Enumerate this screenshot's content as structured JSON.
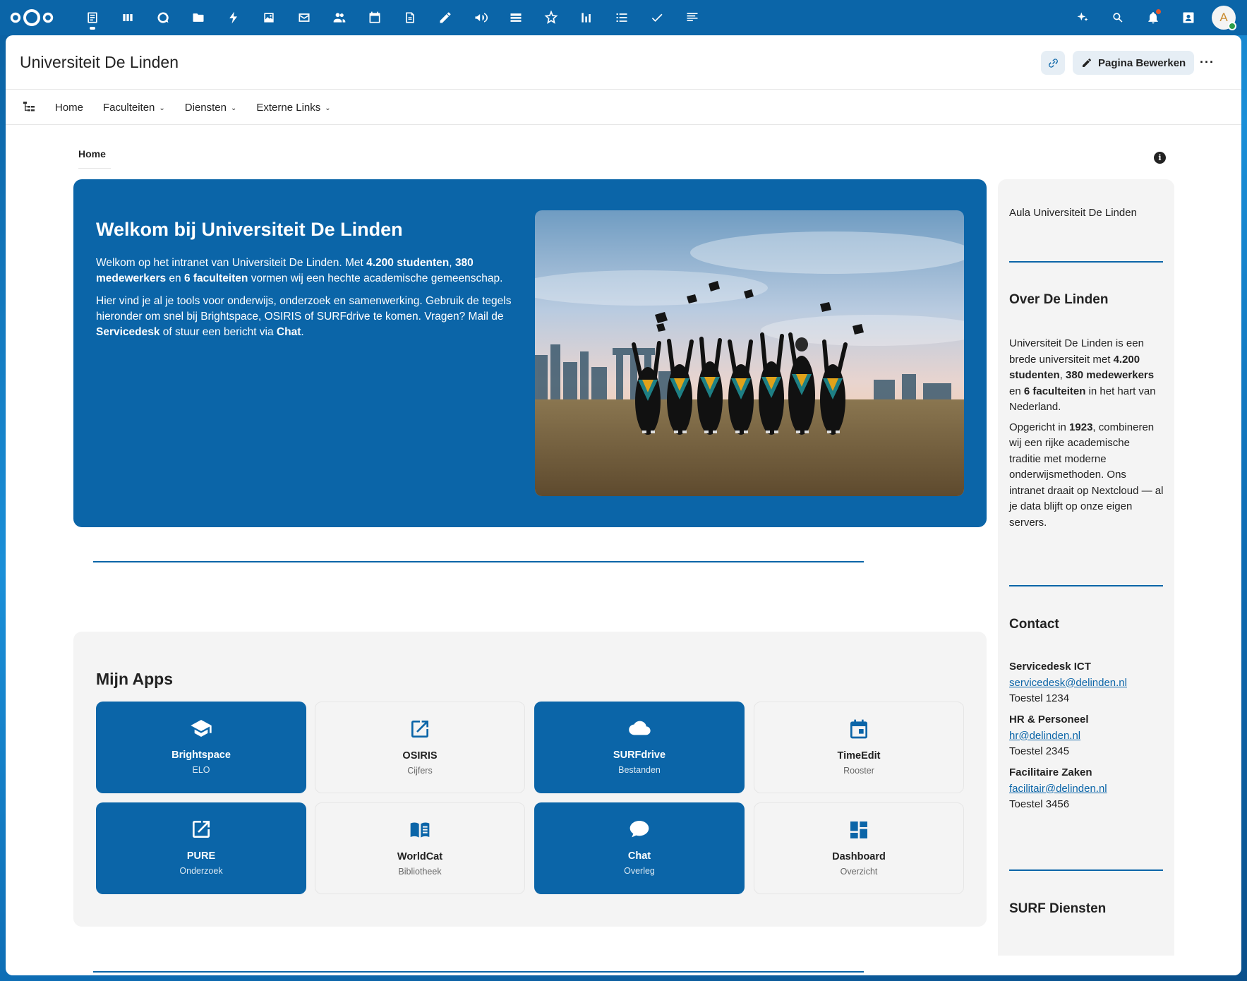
{
  "header": {
    "page_title": "Universiteit De Linden",
    "edit_label": "Pagina Bewerken",
    "more_label": "···"
  },
  "topbar": {
    "apps": [
      "home-app",
      "activity-app",
      "deck-app",
      "talk-app",
      "files-app",
      "flow-app",
      "photos-app",
      "mail-app",
      "contacts-app",
      "calendar-app",
      "notes-app",
      "whiteboard-app",
      "announcements-app",
      "tables-app",
      "collectives-app",
      "analytics-app",
      "tasks-app",
      "done-app",
      "forms-app"
    ],
    "avatar_letter": "A"
  },
  "nav": {
    "items": [
      {
        "label": "Home",
        "dropdown": false
      },
      {
        "label": "Faculteiten",
        "dropdown": true
      },
      {
        "label": "Diensten",
        "dropdown": true
      },
      {
        "label": "Externe Links",
        "dropdown": true
      }
    ]
  },
  "breadcrumb": "Home",
  "hero": {
    "title": "Welkom bij Universiteit De Linden",
    "p1_a": "Welkom op het intranet van Universiteit De Linden. Met ",
    "p1_b": "4.200 studenten",
    "p1_c": ", ",
    "p1_d": "380 medewerkers",
    "p1_e": " en ",
    "p1_f": "6 faculteiten",
    "p1_g": " vormen wij een hechte academische gemeenschap.",
    "p2_a": "Hier vind je al je tools voor onderwijs, onderzoek en samenwerking. Gebruik de tegels hieronder om snel bij Brightspace, OSIRIS of SURFdrive te komen. Vragen? Mail de ",
    "p2_b": "Servicedesk",
    "p2_c": " of stuur een bericht via ",
    "p2_d": "Chat",
    "p2_e": "."
  },
  "apps": {
    "title": "Mijn Apps",
    "tiles": [
      {
        "name": "Brightspace",
        "sub": "ELO",
        "style": "blue",
        "icon": "graduation-cap-icon"
      },
      {
        "name": "OSIRIS",
        "sub": "Cijfers",
        "style": "white",
        "icon": "external-link-icon"
      },
      {
        "name": "SURFdrive",
        "sub": "Bestanden",
        "style": "blue",
        "icon": "cloud-icon"
      },
      {
        "name": "TimeEdit",
        "sub": "Rooster",
        "style": "white",
        "icon": "calendar-icon"
      },
      {
        "name": "PURE",
        "sub": "Onderzoek",
        "style": "blue",
        "icon": "external-link-icon"
      },
      {
        "name": "WorldCat",
        "sub": "Bibliotheek",
        "style": "white",
        "icon": "book-icon"
      },
      {
        "name": "Chat",
        "sub": "Overleg",
        "style": "blue",
        "icon": "chat-bubble-icon"
      },
      {
        "name": "Dashboard",
        "sub": "Overzicht",
        "style": "white",
        "icon": "dashboard-icon"
      }
    ]
  },
  "sidebar": {
    "caption": "Aula Universiteit De Linden",
    "about_title": "Over De Linden",
    "about_p1_a": "Universiteit De Linden is een brede universiteit met ",
    "about_p1_b": "4.200 studenten",
    "about_p1_c": ", ",
    "about_p1_d": "380 medewerkers",
    "about_p1_e": " en ",
    "about_p1_f": "6 faculteiten",
    "about_p1_g": " in het hart van Nederland.",
    "about_p2_a": "Opgericht in ",
    "about_p2_b": "1923",
    "about_p2_c": ", combineren wij een rijke academische traditie met moderne onderwijsmethoden. Ons intranet draait op Nextcloud — al je data blijft op onze eigen servers.",
    "contact_title": "Contact",
    "contacts": [
      {
        "name": "Servicedesk ICT",
        "email": "servicedesk@delinden.nl",
        "phone": "Toestel 1234"
      },
      {
        "name": "HR & Personeel",
        "email": "hr@delinden.nl",
        "phone": "Toestel 2345"
      },
      {
        "name": "Facilitaire Zaken",
        "email": "facilitair@delinden.nl",
        "phone": "Toestel 3456"
      }
    ],
    "surf_title": "SURF Diensten"
  },
  "colors": {
    "accent": "#0b65a8",
    "panel": "#f4f4f4"
  }
}
